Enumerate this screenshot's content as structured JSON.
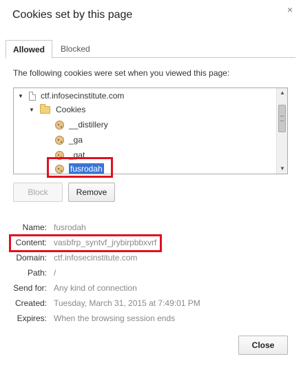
{
  "dialog": {
    "title": "Cookies set by this page",
    "close_glyph": "×"
  },
  "tabs": [
    {
      "label": "Allowed",
      "active": true
    },
    {
      "label": "Blocked",
      "active": false
    }
  ],
  "description": "The following cookies were set when you viewed this page:",
  "tree": {
    "site": "ctf.infosecinstitute.com",
    "folder": "Cookies",
    "cookies": [
      "__distillery",
      "_ga",
      "_gat",
      "fusrodah"
    ],
    "selected": "fusrodah"
  },
  "buttons": {
    "block": "Block",
    "remove": "Remove",
    "close": "Close"
  },
  "details": [
    {
      "label": "Name:",
      "value": "fusrodah"
    },
    {
      "label": "Content:",
      "value": "vasbfrp_syntvf_jrybirpbbxvrf"
    },
    {
      "label": "Domain:",
      "value": "ctf.infosecinstitute.com"
    },
    {
      "label": "Path:",
      "value": "/"
    },
    {
      "label": "Send for:",
      "value": "Any kind of connection"
    },
    {
      "label": "Created:",
      "value": "Tuesday, March 31, 2015 at 7:49:01 PM"
    },
    {
      "label": "Expires:",
      "value": "When the browsing session ends"
    }
  ],
  "colors": {
    "highlight_box": "#e0101f",
    "selection": "#3875d7"
  }
}
